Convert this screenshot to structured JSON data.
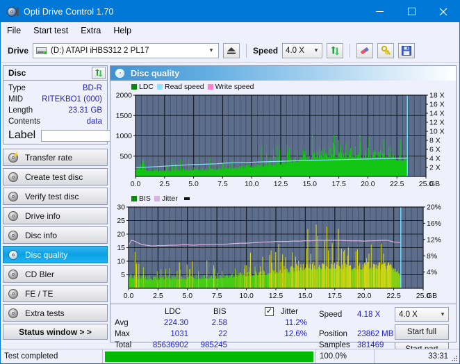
{
  "window": {
    "title": "Opti Drive Control 1.70",
    "icon": "disc-icon",
    "minimize": "minimize-icon",
    "maximize": "maximize-icon",
    "close": "close-icon"
  },
  "menu": {
    "items": [
      {
        "label": "File"
      },
      {
        "label": "Start test"
      },
      {
        "label": "Extra"
      },
      {
        "label": "Help"
      }
    ]
  },
  "toolbar": {
    "drive_label": "Drive",
    "drive_value": "(D:)   ATAPI iHBS312  2 PL17",
    "eject_icon": "eject-icon",
    "speed_label": "Speed",
    "speed_value": "4.0 X",
    "refresh_icon": "refresh-icon",
    "erase_icon": "eraser-icon",
    "tools_icon": "wrench-icon",
    "save_icon": "save-icon"
  },
  "sidebar": {
    "disc_panel": {
      "title": "Disc",
      "refresh_icon": "refresh-icon",
      "rows": [
        {
          "key": "Type",
          "value": "BD-R"
        },
        {
          "key": "MID",
          "value": "RITEKBO1 (000)"
        },
        {
          "key": "Length",
          "value": "23.31 GB"
        },
        {
          "key": "Contents",
          "value": "data"
        }
      ],
      "label_key": "Label",
      "label_value": "",
      "label_placeholder": "",
      "label_button_icon": "disc-icon"
    },
    "nav": [
      {
        "label": "Transfer rate",
        "active": false
      },
      {
        "label": "Create test disc",
        "active": false
      },
      {
        "label": "Verify test disc",
        "active": false
      },
      {
        "label": "Drive info",
        "active": false
      },
      {
        "label": "Disc info",
        "active": false
      },
      {
        "label": "Disc quality",
        "active": true
      },
      {
        "label": "CD Bler",
        "active": false
      },
      {
        "label": "FE / TE",
        "active": false
      },
      {
        "label": "Extra tests",
        "active": false
      }
    ],
    "status_window_button": "Status window > >"
  },
  "main": {
    "header_title": "Disc quality",
    "header_icon": "disc-icon"
  },
  "stats": {
    "col_ldc": "LDC",
    "col_bis": "BIS",
    "jitter_label": "Jitter",
    "jitter_checked": true,
    "rows": [
      {
        "name": "Avg",
        "ldc": "224.30",
        "bis": "2.58",
        "jitter": "11.2%"
      },
      {
        "name": "Max",
        "ldc": "1031",
        "bis": "22",
        "jitter": "12.6%"
      },
      {
        "name": "Total",
        "ldc": "85636902",
        "bis": "985245",
        "jitter": ""
      }
    ],
    "speed_label": "Speed",
    "speed_value": "4.18 X",
    "position_label": "Position",
    "position_value": "23862 MB",
    "samples_label": "Samples",
    "samples_value": "381469",
    "speed_select_value": "4.0 X",
    "start_full_label": "Start full",
    "start_part_label": "Start part"
  },
  "statusbar": {
    "text": "Test completed",
    "percent_label": "100.0%",
    "percent_value": 100,
    "time": "33:31",
    "progress_color": "#00b900"
  },
  "colors": {
    "accent": "#0078d7",
    "plot_bg": "#5d6d8c",
    "grid": "#3a4458",
    "ldc_green": "#13c513",
    "bis_green": "#46cc17",
    "bis_yellow": "#d4d416",
    "read_speed": "#8fe3ff",
    "write_speed": "#ff7fd4",
    "jitter_pink": "#d7b4e0",
    "value_blue": "#2020d0"
  },
  "chart_data": [
    {
      "type": "area",
      "id": "disc-quality-ldc-chart",
      "title": "Disc quality",
      "xlabel": "GB",
      "ylabel": "LDC",
      "xlim": [
        0,
        25
      ],
      "ylim": [
        0,
        2000
      ],
      "y2lim": [
        0,
        18
      ],
      "y2label": "X",
      "grid": true,
      "legend_position": "top-left",
      "legend": [
        "LDC",
        "Read speed",
        "Write speed"
      ],
      "xticks": [
        "0.0",
        "2.5",
        "5.0",
        "7.5",
        "10.0",
        "12.5",
        "15.0",
        "17.5",
        "20.0",
        "22.5",
        "25.0"
      ],
      "yticks": [
        500,
        1000,
        1500,
        2000
      ],
      "y2ticks": [
        "2 X",
        "4 X",
        "6 X",
        "8 X",
        "10 X",
        "12 X",
        "14 X",
        "16 X",
        "18 X"
      ],
      "data_end_x": 23.4,
      "cursor_x": 23.4,
      "series": [
        {
          "name": "LDC",
          "color": "#13c513",
          "kind": "area-spikes",
          "x": [
            0.0,
            0.3,
            0.7,
            1.1,
            1.5,
            2.0,
            2.5,
            3.0,
            3.5,
            4.0,
            4.5,
            5.0,
            5.5,
            6.0,
            6.5,
            7.0,
            7.5,
            8.0,
            8.5,
            9.0,
            9.5,
            10.0,
            10.5,
            11.0,
            11.5,
            12.0,
            12.5,
            13.0,
            13.5,
            14.0,
            14.5,
            15.0,
            15.5,
            16.0,
            16.5,
            17.0,
            17.5,
            18.0,
            18.5,
            19.0,
            19.5,
            20.0,
            20.5,
            21.0,
            21.5,
            22.0,
            22.5,
            23.0,
            23.4
          ],
          "base": [
            230,
            250,
            215,
            190,
            180,
            175,
            180,
            185,
            190,
            195,
            200,
            205,
            200,
            205,
            215,
            220,
            225,
            240,
            250,
            270,
            290,
            300,
            320,
            340,
            360,
            390,
            420,
            450,
            480,
            520,
            560,
            600,
            630,
            650,
            655,
            640,
            625,
            615,
            610,
            615,
            620,
            630,
            640,
            645,
            630,
            600,
            560,
            520,
            500
          ],
          "peak": [
            500,
            470,
            420,
            380,
            360,
            350,
            370,
            380,
            400,
            420,
            430,
            450,
            440,
            450,
            470,
            470,
            500,
            520,
            540,
            560,
            590,
            600,
            640,
            660,
            700,
            740,
            790,
            820,
            850,
            900,
            930,
            950,
            960,
            940,
            930,
            910,
            900,
            890,
            890,
            900,
            910,
            930,
            940,
            930,
            900,
            860,
            800,
            760,
            740
          ]
        },
        {
          "name": "Read speed",
          "color": "#8fe3ff",
          "kind": "line",
          "x": [
            0.0,
            1.0,
            2.0,
            3.0,
            4.0,
            5.0,
            6.0,
            7.0,
            7.6,
            9.0,
            10.5,
            12.0,
            13.5,
            15.0,
            16.5,
            18.0,
            19.5,
            21.0,
            22.4,
            23.4
          ],
          "y_speed": [
            1.95,
            2.05,
            2.2,
            2.35,
            2.5,
            2.65,
            2.7,
            2.8,
            2.95,
            3.05,
            3.2,
            3.3,
            3.45,
            3.55,
            3.65,
            3.75,
            3.85,
            3.92,
            4.0,
            4.05
          ]
        },
        {
          "name": "Write speed",
          "color": "#ff7fd4",
          "kind": "line",
          "x": [],
          "y_speed": []
        }
      ]
    },
    {
      "type": "area",
      "id": "disc-quality-bis-chart",
      "title": "",
      "xlabel": "GB",
      "ylabel": "BIS",
      "xlim": [
        0,
        25
      ],
      "ylim": [
        0,
        30
      ],
      "y2lim": [
        0,
        20
      ],
      "y2label": "%",
      "grid": true,
      "legend_position": "top-left",
      "legend": [
        "BIS",
        "Jitter"
      ],
      "xticks": [
        "0.0",
        "2.5",
        "5.0",
        "7.5",
        "10.0",
        "12.5",
        "15.0",
        "17.5",
        "20.0",
        "22.5",
        "25.0"
      ],
      "yticks": [
        5,
        10,
        15,
        20,
        25,
        30
      ],
      "y2ticks": [
        "4%",
        "8%",
        "12%",
        "16%",
        "20%"
      ],
      "data_end_x": 23.1,
      "cursor_x": 23.1,
      "series": [
        {
          "name": "BIS",
          "color": "#46cc17",
          "color_high": "#d4d416",
          "kind": "area-spikes",
          "x": [
            0.0,
            0.4,
            0.8,
            1.3,
            1.8,
            2.4,
            3.0,
            3.6,
            4.2,
            4.8,
            5.4,
            6.0,
            6.6,
            7.2,
            7.8,
            8.4,
            9.0,
            9.6,
            10.2,
            10.8,
            11.4,
            12.0,
            12.6,
            13.2,
            13.8,
            14.4,
            15.0,
            15.6,
            16.2,
            16.8,
            17.4,
            18.0,
            18.6,
            19.2,
            19.8,
            20.4,
            21.0,
            21.6,
            22.2,
            22.8,
            23.1
          ],
          "base": [
            5.5,
            5.2,
            4.8,
            4.6,
            4.5,
            4.5,
            4.6,
            4.6,
            4.7,
            4.7,
            4.8,
            4.8,
            4.9,
            5.0,
            5.2,
            5.5,
            5.8,
            6.1,
            6.4,
            6.7,
            7.0,
            7.4,
            7.8,
            8.2,
            8.8,
            9.3,
            9.8,
            10.1,
            10.3,
            10.4,
            10.4,
            10.3,
            10.2,
            10.1,
            10.0,
            10.1,
            10.3,
            10.4,
            9.8,
            8.0,
            6.0
          ],
          "peak": [
            13.0,
            12.0,
            10.5,
            9.5,
            9.0,
            9.0,
            9.2,
            9.4,
            9.6,
            9.6,
            9.8,
            9.8,
            10.0,
            10.2,
            10.6,
            11.2,
            12.0,
            12.6,
            13.0,
            13.4,
            13.8,
            14.2,
            14.6,
            15.0,
            15.8,
            18.5,
            20.5,
            19.5,
            21.5,
            19.0,
            22.0,
            18.5,
            17.5,
            18.0,
            17.0,
            17.5,
            18.5,
            17.0,
            16.0,
            14.0,
            14.0
          ]
        },
        {
          "name": "Jitter",
          "color": "#d7b4e0",
          "kind": "line",
          "x": [
            0.0,
            0.25,
            0.5,
            1.0,
            1.5,
            2.0,
            2.5,
            3.0,
            3.5,
            4.0,
            4.5,
            5.0,
            5.5,
            6.0,
            6.5,
            7.0,
            7.5,
            8.0,
            8.5,
            9.0,
            9.5,
            10.0,
            10.5,
            11.0,
            11.5,
            12.0,
            12.5,
            13.0,
            13.5,
            14.0,
            14.5,
            15.0,
            15.5,
            16.0,
            16.5,
            17.0,
            17.5,
            18.0,
            18.5,
            19.0,
            19.5,
            20.0,
            20.5,
            21.0,
            21.5,
            22.0,
            22.5,
            23.1
          ],
          "y_pct": [
            10.6,
            11.8,
            11.6,
            10.9,
            10.6,
            10.4,
            10.5,
            10.5,
            10.6,
            10.6,
            10.7,
            10.7,
            10.6,
            10.7,
            10.7,
            10.8,
            10.8,
            10.8,
            10.9,
            11.0,
            11.1,
            11.1,
            11.2,
            11.3,
            11.4,
            11.4,
            11.5,
            11.5,
            11.5,
            11.6,
            11.6,
            11.7,
            11.7,
            11.8,
            11.8,
            11.8,
            11.8,
            11.8,
            11.7,
            11.7,
            11.7,
            11.6,
            11.7,
            11.7,
            11.8,
            11.8,
            11.4,
            11.3
          ]
        }
      ]
    }
  ]
}
